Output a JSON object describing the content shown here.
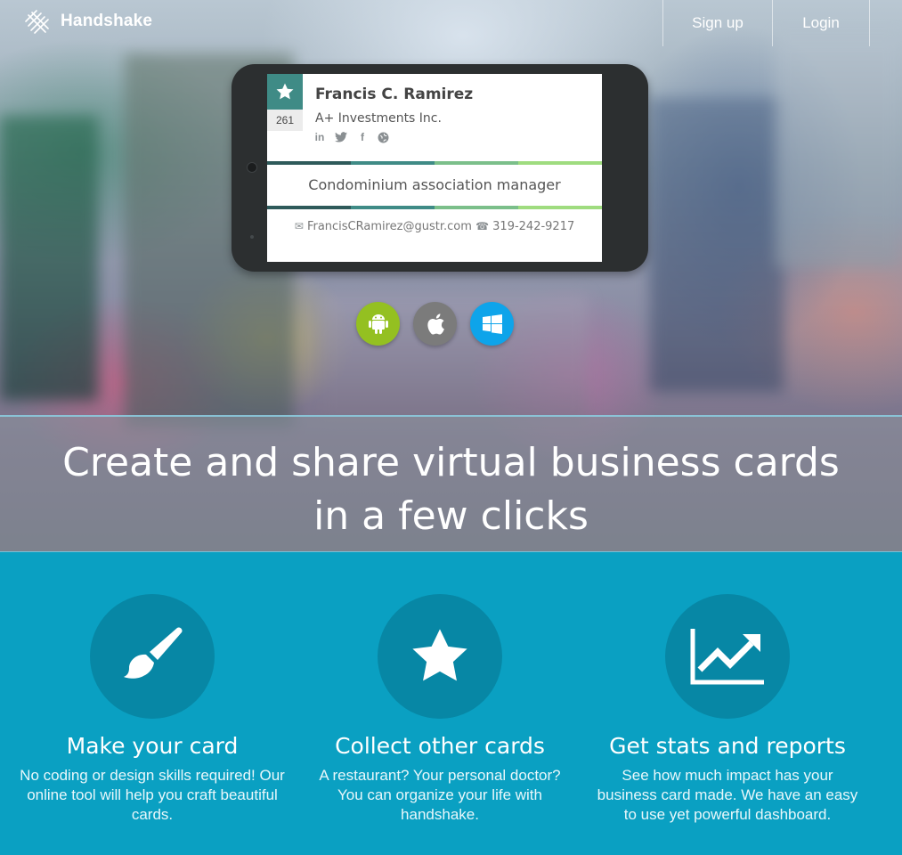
{
  "brand": {
    "name": "Handshake",
    "icon": "handshake-logo-icon"
  },
  "nav": {
    "signup_label": "Sign up",
    "login_label": "Login"
  },
  "card": {
    "name": "Francis C. Ramirez",
    "company": "A+ Investments Inc.",
    "count": "261",
    "socials": [
      "linkedin-icon",
      "twitter-icon",
      "facebook-icon",
      "globe-icon"
    ],
    "job_title": "Condominium association manager",
    "email": "FrancisCRamirez@gustr.com",
    "phone": "319-242-9217",
    "stripe_colors": [
      "#2e5a5a",
      "#3f8b86",
      "#7bbf8a",
      "#9fdc7f"
    ]
  },
  "platforms": [
    {
      "icon": "android-icon",
      "color": "#94c021"
    },
    {
      "icon": "apple-icon",
      "color": "#7b7b7b"
    },
    {
      "icon": "windows-icon",
      "color": "#0ea4ea"
    }
  ],
  "headline": {
    "line1": "Create and share virtual business cards",
    "line2": "in a few clicks"
  },
  "features": [
    {
      "icon": "paintbrush-icon",
      "title": "Make your card",
      "text": "No coding or design skills required! Our online tool will help you craft beautiful cards."
    },
    {
      "icon": "star-icon",
      "title": "Collect other cards",
      "text": "A restaurant? Your personal doctor? You can organize your life with handshake."
    },
    {
      "icon": "chart-up-icon",
      "title": "Get stats and reports",
      "text": "See how much impact has your business card made. We have an easy to use yet powerful dashboard."
    }
  ],
  "colors": {
    "accent": "#0aa0c2",
    "circle": "#0787a5",
    "card_teal": "#3f8b86"
  }
}
